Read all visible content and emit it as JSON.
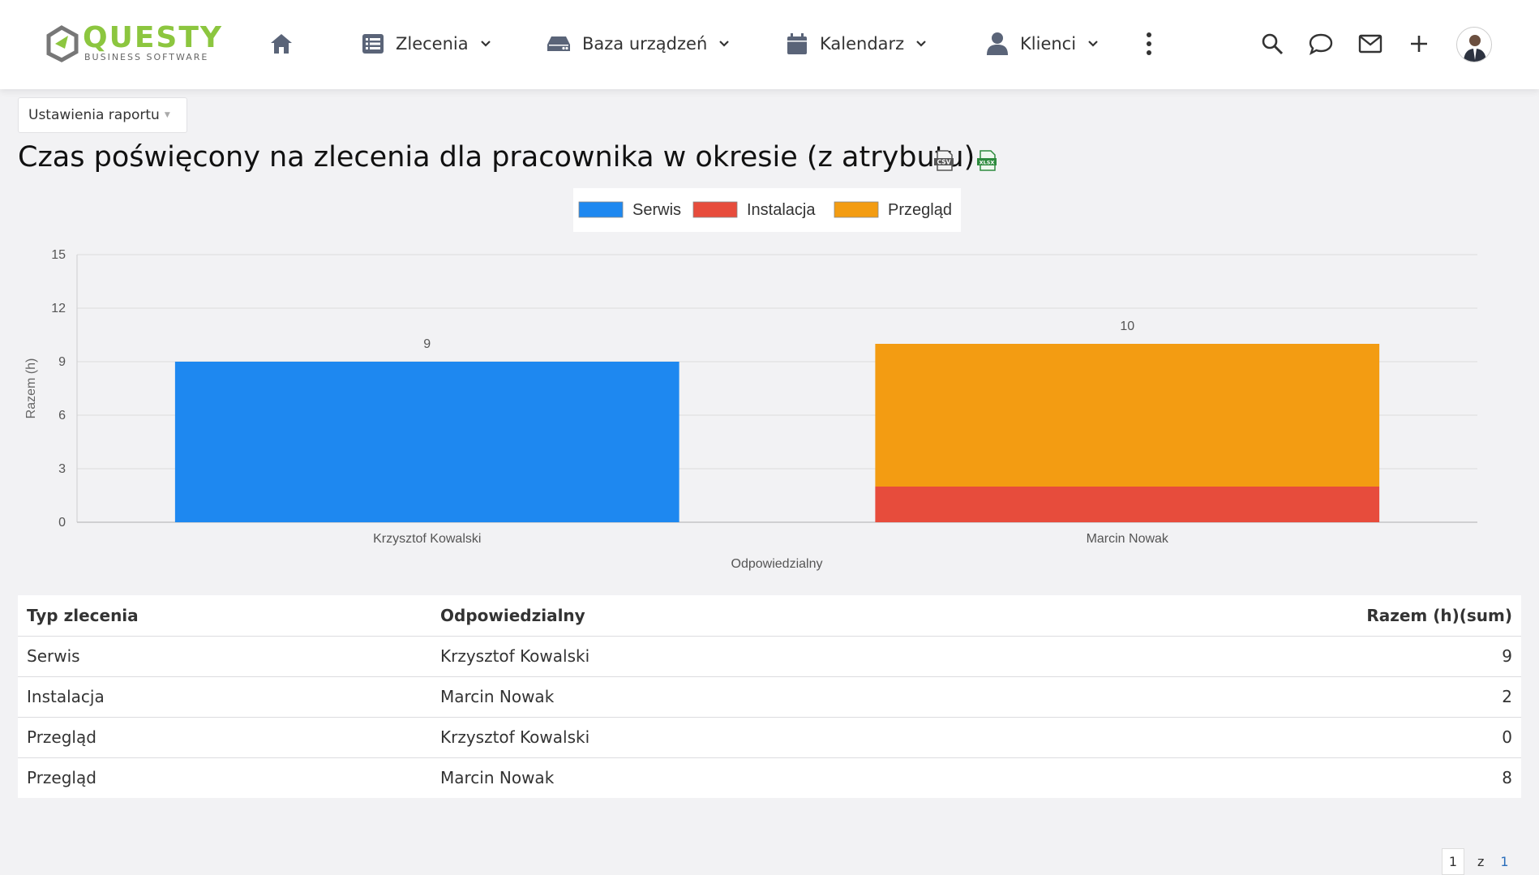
{
  "brand": {
    "name": "QUESTY",
    "subtitle": "BUSINESS SOFTWARE",
    "color": "#8cc63f"
  },
  "nav": {
    "home_icon": "home-icon",
    "items": [
      {
        "label": "Zlecenia",
        "icon": "list-icon"
      },
      {
        "label": "Baza urządzeń",
        "icon": "drive-icon"
      },
      {
        "label": "Kalendarz",
        "icon": "calendar-icon"
      },
      {
        "label": "Klienci",
        "icon": "user-icon"
      }
    ],
    "more_icon": "more-vertical-icon",
    "right_icons": [
      "search-icon",
      "chat-icon",
      "mail-icon",
      "plus-icon"
    ]
  },
  "report": {
    "settings_label": "Ustawienia raportu",
    "title": "Czas poświęcony na zlecenia dla pracownika w okresie (z atrybutu)",
    "export_icons": [
      "csv-export-icon",
      "xlsx-export-icon"
    ]
  },
  "chart_data": {
    "type": "bar",
    "stacked": true,
    "categories": [
      "Krzysztof Kowalski",
      "Marcin Nowak"
    ],
    "series": [
      {
        "name": "Serwis",
        "values": [
          9,
          0
        ],
        "color": "#1e88f0"
      },
      {
        "name": "Instalacja",
        "values": [
          0,
          2
        ],
        "color": "#e74c3c"
      },
      {
        "name": "Przegląd",
        "values": [
          0,
          8
        ],
        "color": "#f39c12"
      }
    ],
    "totals": [
      9,
      10
    ],
    "xlabel": "Odpowiedzialny",
    "ylabel": "Razem (h)",
    "ylim": [
      0,
      15
    ],
    "yticks": [
      0,
      3,
      6,
      9,
      12,
      15
    ],
    "grid": true,
    "legend": "top-center"
  },
  "table": {
    "headers": [
      "Typ zlecenia",
      "Odpowiedzialny",
      "Razem (h)(sum)"
    ],
    "rows": [
      [
        "Serwis",
        "Krzysztof Kowalski",
        "9"
      ],
      [
        "Instalacja",
        "Marcin Nowak",
        "2"
      ],
      [
        "Przegląd",
        "Krzysztof Kowalski",
        "0"
      ],
      [
        "Przegląd",
        "Marcin Nowak",
        "8"
      ]
    ]
  },
  "pagination": {
    "current": "1",
    "of": "z",
    "total": "1"
  }
}
